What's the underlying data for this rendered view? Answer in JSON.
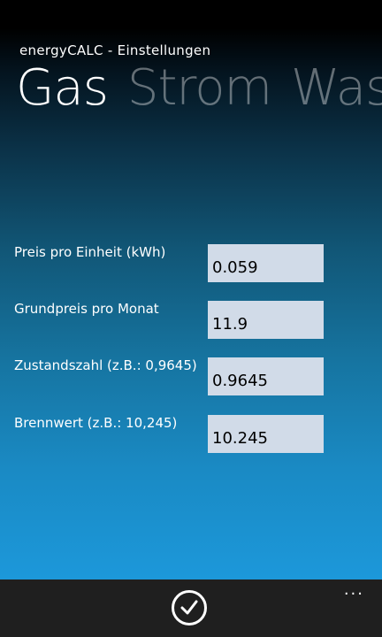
{
  "app": {
    "title": "energyCALC - Einstellungen"
  },
  "pivot": {
    "items": [
      {
        "label": "Gas",
        "active": true
      },
      {
        "label": "Strom",
        "active": false
      },
      {
        "label": "Was",
        "active": false
      }
    ]
  },
  "settings": {
    "fields": [
      {
        "label": "Preis pro Einheit (kWh)",
        "value": "0.059"
      },
      {
        "label": "Grundpreis pro Monat",
        "value": "11.9"
      },
      {
        "label": "Zustandszahl (z.B.: 0,9645)",
        "value": "0.9645"
      },
      {
        "label": "Brennwert (z.B.: 10,245)",
        "value": "10.245"
      }
    ]
  },
  "app_bar": {
    "confirm_icon": "check-circle-icon",
    "more_icon": "ellipsis-icon",
    "more_glyph": "..."
  },
  "colors": {
    "field_background": "#d1dbe8",
    "app_bar_background": "#1f1f1f",
    "gradient_bottom": "#1c98da"
  }
}
